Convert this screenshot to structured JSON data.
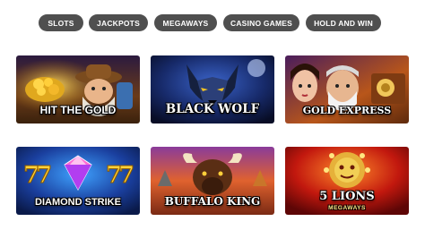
{
  "categories": {
    "slots": "SLOTS",
    "jackpots": "JACKPOTS",
    "megaways": "MEGAWAYS",
    "casino_games": "CASINO GAMES",
    "hold_and_win": "HOLD AND WIN"
  },
  "games": {
    "hit_the_gold": {
      "title": "HIT THE GOLD"
    },
    "black_wolf": {
      "title": "BLACK WOLF"
    },
    "gold_express": {
      "title": "GOLD EXPRESS"
    },
    "diamond_strike": {
      "title": "DIAMOND STRIKE"
    },
    "buffalo_king": {
      "title": "BUFFALO KING"
    },
    "five_lions": {
      "title": "5 LIONS",
      "subtitle": "MEGAWAYS"
    }
  },
  "colors": {
    "tab_background": "#4f4f4f",
    "tab_text": "#ffffff",
    "page_background": "#ffffff"
  }
}
